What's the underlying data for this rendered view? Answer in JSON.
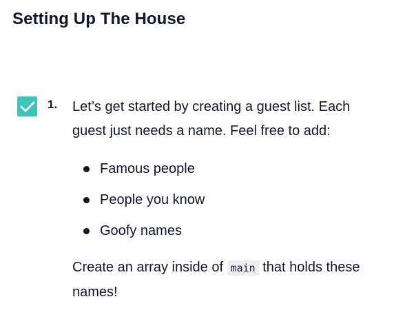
{
  "heading": "Setting Up The House",
  "task": {
    "checked": true,
    "number": "1.",
    "intro": "Let’s get started by creating a guest list. Each guest just needs a name. Feel free to add:",
    "items": [
      "Famous people",
      "People you know",
      "Goofy names"
    ],
    "outro_before": "Create an array inside of ",
    "outro_code": "main",
    "outro_after": " that holds these names!"
  },
  "colors": {
    "text": "#10162f",
    "checkbox": "#3fc4b8",
    "code_bg": "#eeeeef"
  },
  "icons": {
    "checkbox": "checkmark-icon",
    "bullet": "bullet-dot-icon"
  }
}
